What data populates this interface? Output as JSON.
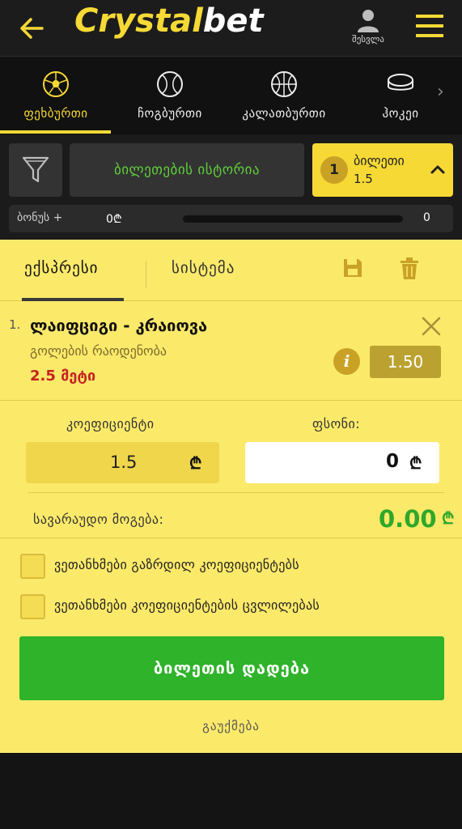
{
  "header": {
    "logo_part1": "Crystal",
    "logo_part2": "bet",
    "login_label": "შესვლა",
    "back_icon": "arrow-left-icon",
    "menu_icon": "hamburger-menu-icon"
  },
  "sports": [
    {
      "label": "ფეხბურთი",
      "icon": "soccer-ball-icon",
      "active": true
    },
    {
      "label": "ჩოგბურთი",
      "icon": "tennis-ball-icon",
      "active": false
    },
    {
      "label": "კალათბურთი",
      "icon": "basketball-icon",
      "active": false
    },
    {
      "label": "ჰოკეი",
      "icon": "hockey-puck-icon",
      "active": false
    }
  ],
  "toolbar": {
    "history_label": "ბილეთების ისტორია",
    "ticket_count": "1",
    "ticket_label": "ბილეთი",
    "ticket_odds": "1.5"
  },
  "bonus": {
    "label": "ბონუს +",
    "value": "0₾",
    "end_value": "0",
    "progress": 0
  },
  "betslip": {
    "tabs": [
      {
        "label": "ექსპრესი",
        "active": true
      },
      {
        "label": "სისტემა",
        "active": false
      }
    ],
    "bet": {
      "number": "1.",
      "match": "ლაიფციგი - კრაიოვა",
      "market": "გოლების რაოდენობა",
      "pick": "2.5 მეტი",
      "odds": "1.50"
    },
    "coef_label": "კოეფიციენტი",
    "coef_value": "1.5",
    "stake_label": "ფსონი:",
    "stake_value": "0",
    "currency": "₾",
    "possible_label": "სავარაუდო მოგება:",
    "possible_value": "0.00",
    "check1": "ვეთანხმები გაზრდილ კოეფიციენტებს",
    "check2": "ვეთანხმები კოეფიციენტების ცვლილებას",
    "place_label": "ბილეთის დადება",
    "cancel_label": "გაუქმება"
  },
  "colors": {
    "brand_yellow": "#f6d935",
    "panel_yellow": "#fbe96a",
    "green": "#2fb32a",
    "red": "#c42424"
  }
}
